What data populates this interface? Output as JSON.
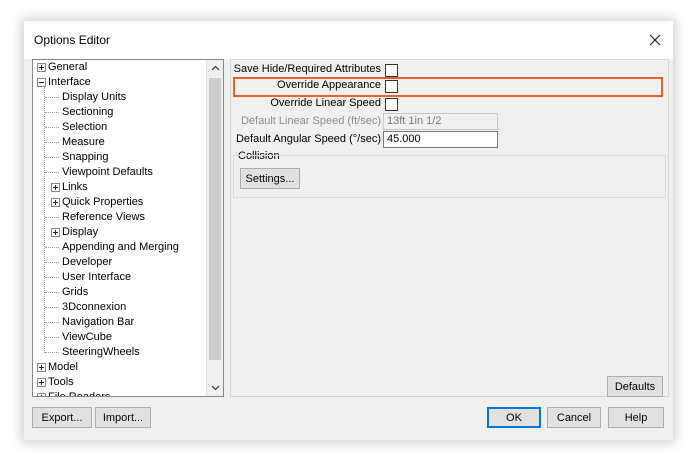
{
  "window": {
    "title": "Options Editor"
  },
  "tree": {
    "items": [
      {
        "label": "General",
        "level": 0,
        "expander": "plus"
      },
      {
        "label": "Interface",
        "level": 0,
        "expander": "minus"
      },
      {
        "label": "Display Units",
        "level": 1,
        "expander": "none"
      },
      {
        "label": "Sectioning",
        "level": 1,
        "expander": "none"
      },
      {
        "label": "Selection",
        "level": 1,
        "expander": "none"
      },
      {
        "label": "Measure",
        "level": 1,
        "expander": "none"
      },
      {
        "label": "Snapping",
        "level": 1,
        "expander": "none"
      },
      {
        "label": "Viewpoint Defaults",
        "level": 1,
        "expander": "none"
      },
      {
        "label": "Links",
        "level": 1,
        "expander": "plus"
      },
      {
        "label": "Quick Properties",
        "level": 1,
        "expander": "plus"
      },
      {
        "label": "Reference Views",
        "level": 1,
        "expander": "none"
      },
      {
        "label": "Display",
        "level": 1,
        "expander": "plus"
      },
      {
        "label": "Appending and Merging",
        "level": 1,
        "expander": "none"
      },
      {
        "label": "Developer",
        "level": 1,
        "expander": "none"
      },
      {
        "label": "User Interface",
        "level": 1,
        "expander": "none"
      },
      {
        "label": "Grids",
        "level": 1,
        "expander": "none"
      },
      {
        "label": "3Dconnexion",
        "level": 1,
        "expander": "none"
      },
      {
        "label": "Navigation Bar",
        "level": 1,
        "expander": "none"
      },
      {
        "label": "ViewCube",
        "level": 1,
        "expander": "none"
      },
      {
        "label": "SteeringWheels",
        "level": 1,
        "expander": "none"
      },
      {
        "label": "Model",
        "level": 0,
        "expander": "plus"
      },
      {
        "label": "Tools",
        "level": 0,
        "expander": "plus"
      },
      {
        "label": "File Readers",
        "level": 0,
        "expander": "plus"
      }
    ]
  },
  "settings": {
    "save_hide_label": "Save Hide/Required Attributes",
    "override_appearance_label": "Override Appearance",
    "override_linear_speed_label": "Override Linear Speed",
    "default_linear_speed_label": "Default Linear Speed (ft/sec)",
    "default_linear_speed_value": "13ft 1in 1/2",
    "default_angular_speed_label": "Default Angular Speed (°/sec)",
    "default_angular_speed_value": "45.000",
    "collision_label": "Collision",
    "settings_button": "Settings..."
  },
  "buttons": {
    "defaults": "Defaults",
    "export": "Export...",
    "import": "Import...",
    "ok": "OK",
    "cancel": "Cancel",
    "help": "Help"
  },
  "colors": {
    "highlight": "#e8622a",
    "primary_border": "#0078d7"
  }
}
